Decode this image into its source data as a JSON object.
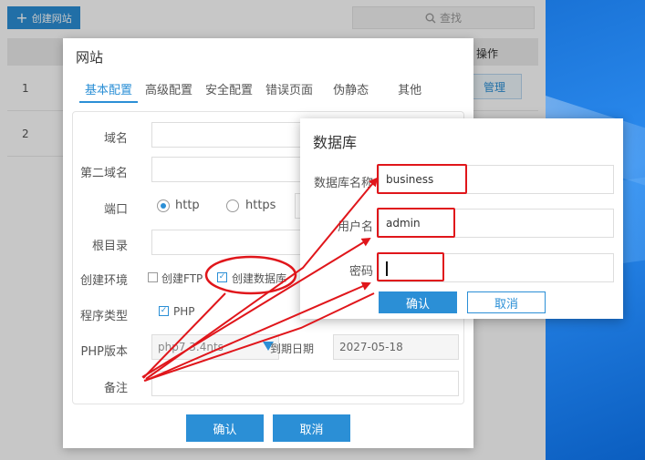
{
  "page": {
    "create_site_label": "创建网站",
    "search_placeholder": "查找",
    "ops_column": "操作",
    "rows": [
      {
        "num": "1"
      },
      {
        "num": "2"
      }
    ],
    "manage_label": "管理"
  },
  "site_dialog": {
    "title": "网站",
    "tabs": [
      "基本配置",
      "高级配置",
      "安全配置",
      "错误页面",
      "伪静态",
      "其他"
    ],
    "active_tab": "基本配置",
    "fields": {
      "domain": "域名",
      "second_domain": "第二域名",
      "port": "端口",
      "root_dir": "根目录",
      "env": "创建环境",
      "program_type": "程序类型",
      "php_version": "PHP版本",
      "note": "备注"
    },
    "port_options": [
      "http",
      "https"
    ],
    "env_options": {
      "ftp": "创建FTP",
      "db": "创建数据库"
    },
    "program_option": "PHP",
    "php_version_value": "php7.3.4nts",
    "expire_label": "到期日期",
    "expire_value": "2027-05-18",
    "confirm_label": "确认",
    "cancel_label": "取消"
  },
  "db_dialog": {
    "title": "数据库",
    "name_label": "数据库名称",
    "name_value": "business",
    "user_label": "用户名",
    "user_value": "admin",
    "password_label": "密码",
    "password_value": "",
    "confirm_label": "确认",
    "cancel_label": "取消"
  },
  "colors": {
    "accent": "#2b8fd6",
    "highlight": "#e0161b",
    "desktop": "#1a73d6"
  }
}
